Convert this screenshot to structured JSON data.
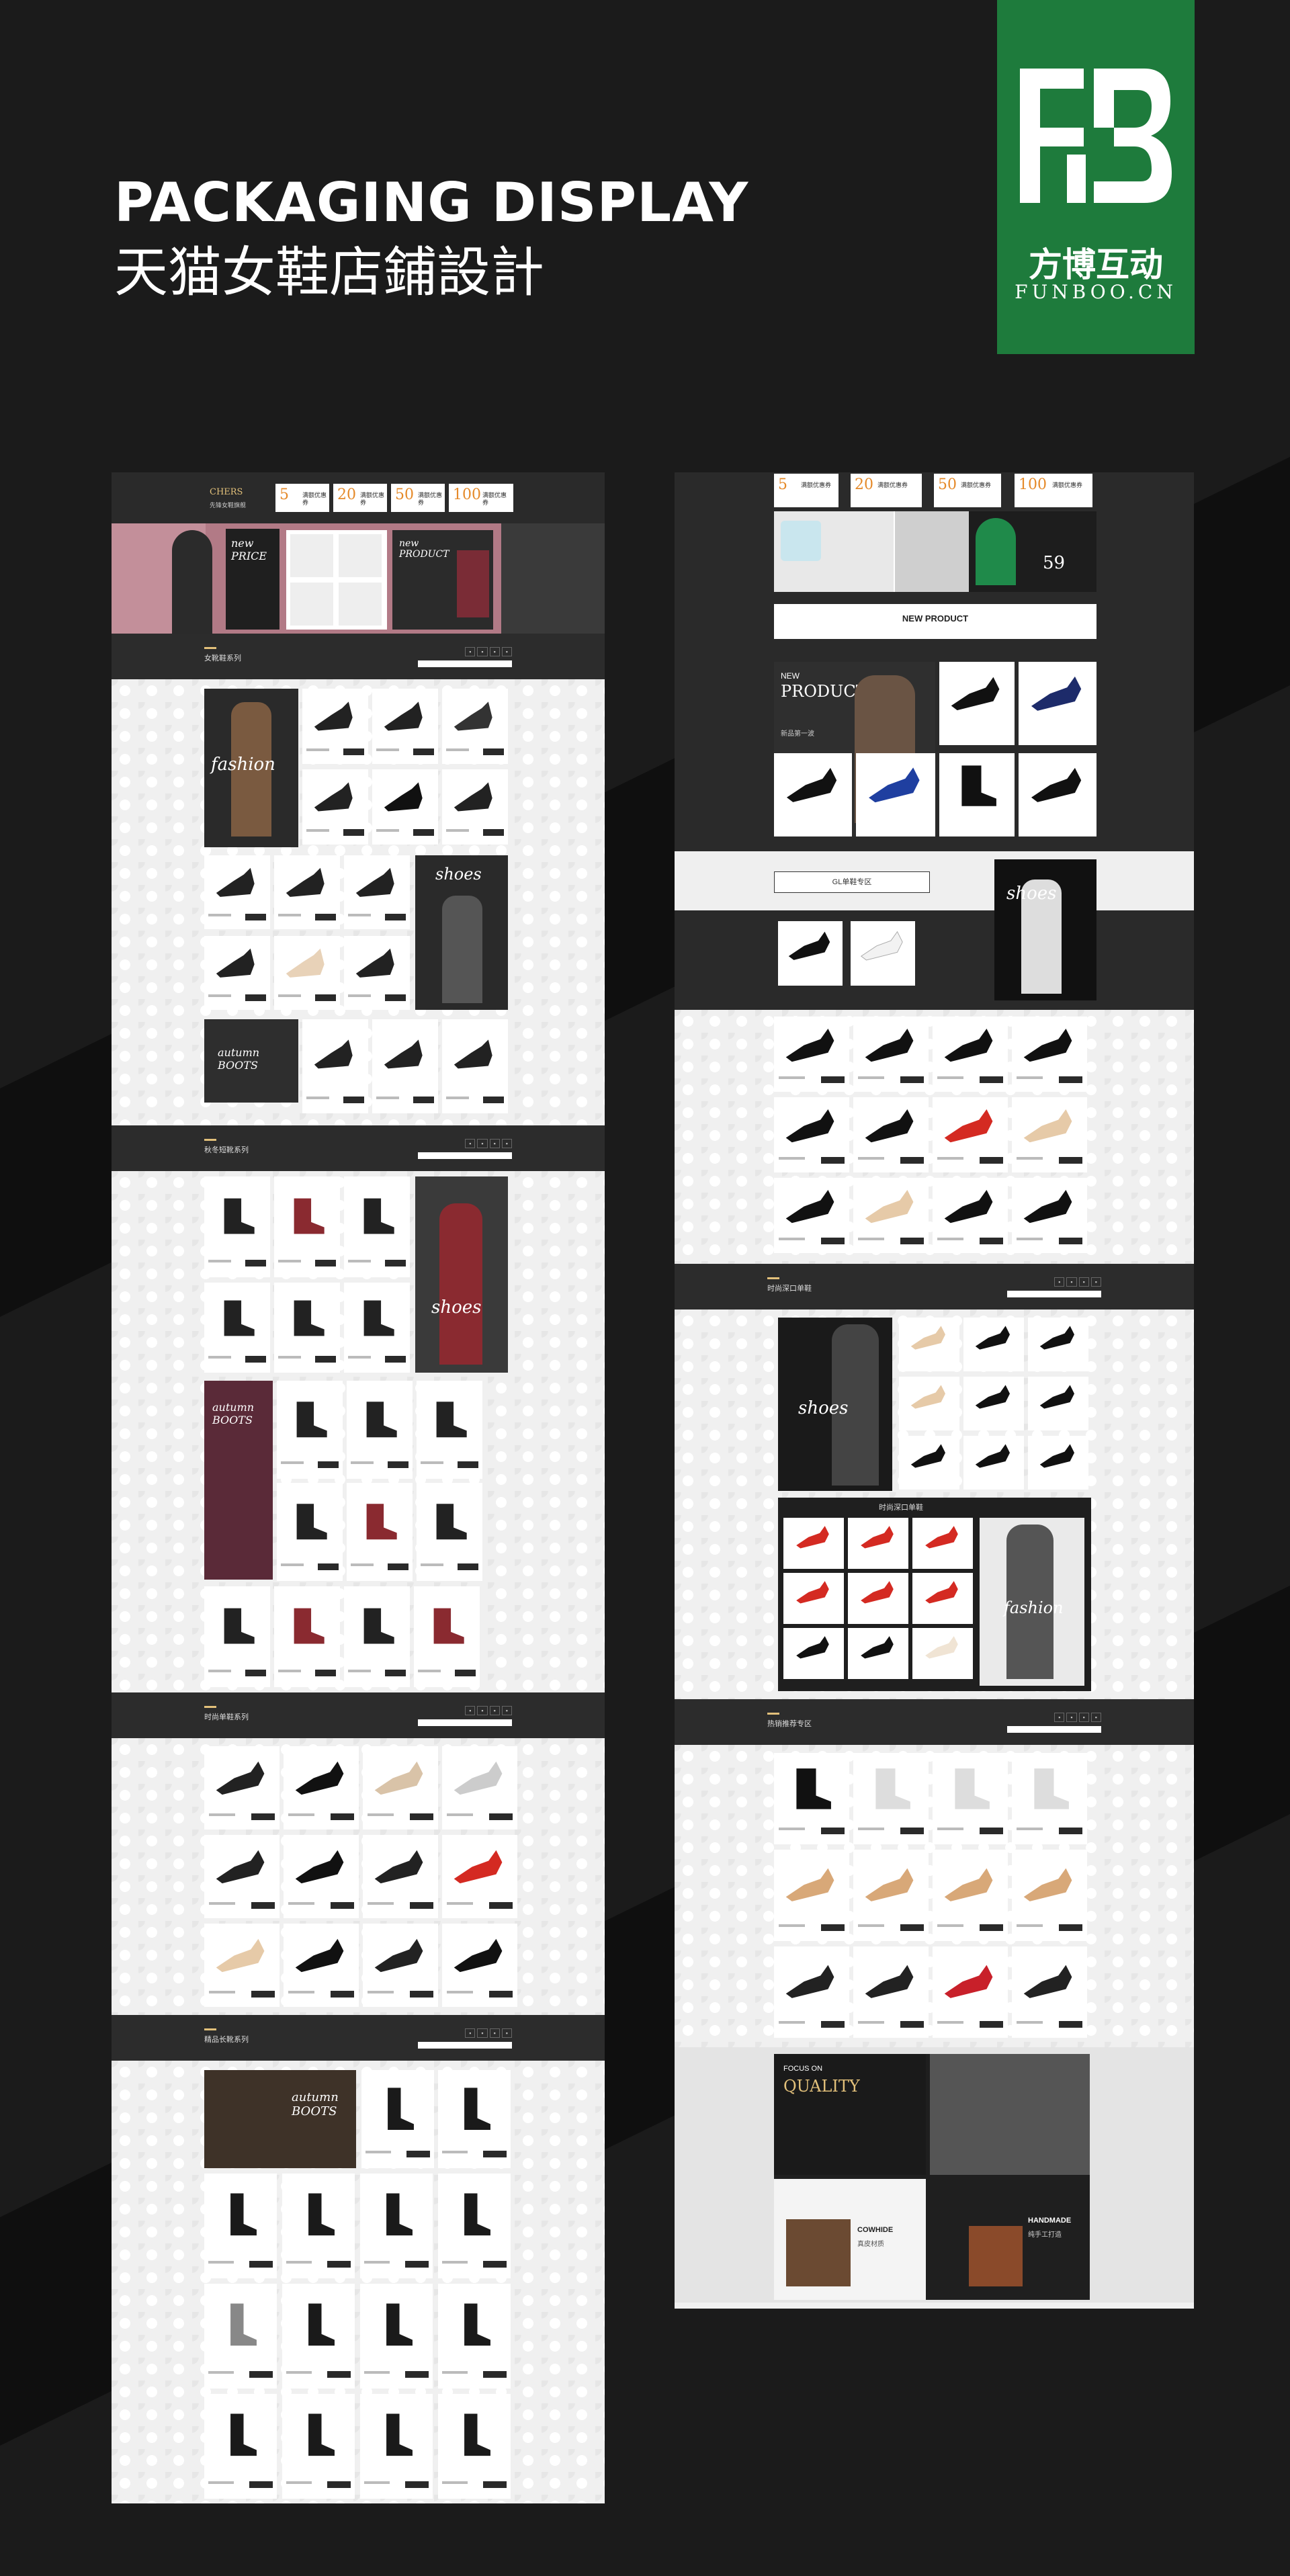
{
  "hero": {
    "title_en": "PACKAGING DISPLAY",
    "title_cn": "天猫女鞋店鋪設計"
  },
  "brand": {
    "name_cn": "方博互动",
    "name_en": "FUNBOO.CN",
    "color": "#1e7b3c",
    "icon": "funboo-logo-icon"
  },
  "left_page": {
    "header_brand": "CHERS",
    "sub_brand": "先锋女鞋旗舰",
    "coupons": [
      {
        "amount": "5",
        "text": "满额优惠券"
      },
      {
        "amount": "20",
        "text": "满额优惠券"
      },
      {
        "amount": "50",
        "text": "满额优惠券"
      },
      {
        "amount": "100",
        "text": "满额优惠券"
      }
    ],
    "banner": {
      "left_script": "new PRICE",
      "right_label": "new PRODUCT"
    },
    "sections": [
      {
        "title": "女靴鞋系列",
        "promo1": "fashion",
        "promo2": "shoes",
        "promo3": "autumn BOOTS"
      },
      {
        "title": "秋冬短靴系列",
        "promo1": "shoes",
        "promo2": "autumn BOOTS"
      },
      {
        "title": "时尚单鞋系列"
      },
      {
        "title": "精品长靴系列",
        "promo1": "autumn BOOTS"
      }
    ]
  },
  "right_page": {
    "coupons": [
      {
        "amount": "5",
        "text": "满额优惠券"
      },
      {
        "amount": "20",
        "text": "满额优惠券"
      },
      {
        "amount": "50",
        "text": "满额优惠券"
      },
      {
        "amount": "100",
        "text": "满额优惠券"
      }
    ],
    "banner_price": "59",
    "new_product_bar": "NEW PRODUCT",
    "new_product_block": {
      "line1": "NEW",
      "line2": "PRODUCT",
      "sub": "新品第一波"
    },
    "gl_zone": {
      "label": "GL单鞋专区",
      "promo": "shoes"
    },
    "sections": [
      {
        "title": "时尚深口单鞋",
        "promo1": "shoes",
        "sub_banner": "时尚深口单鞋",
        "promo2": "fashion"
      },
      {
        "title": "热销推荐专区"
      }
    ],
    "quality": {
      "title1": "FOCUS ON",
      "title2": "QUALITY",
      "card1_en": "COWHIDE",
      "card1_cn": "真皮材质",
      "card2_en": "HANDMADE",
      "card2_cn": "纯手工打造"
    }
  }
}
